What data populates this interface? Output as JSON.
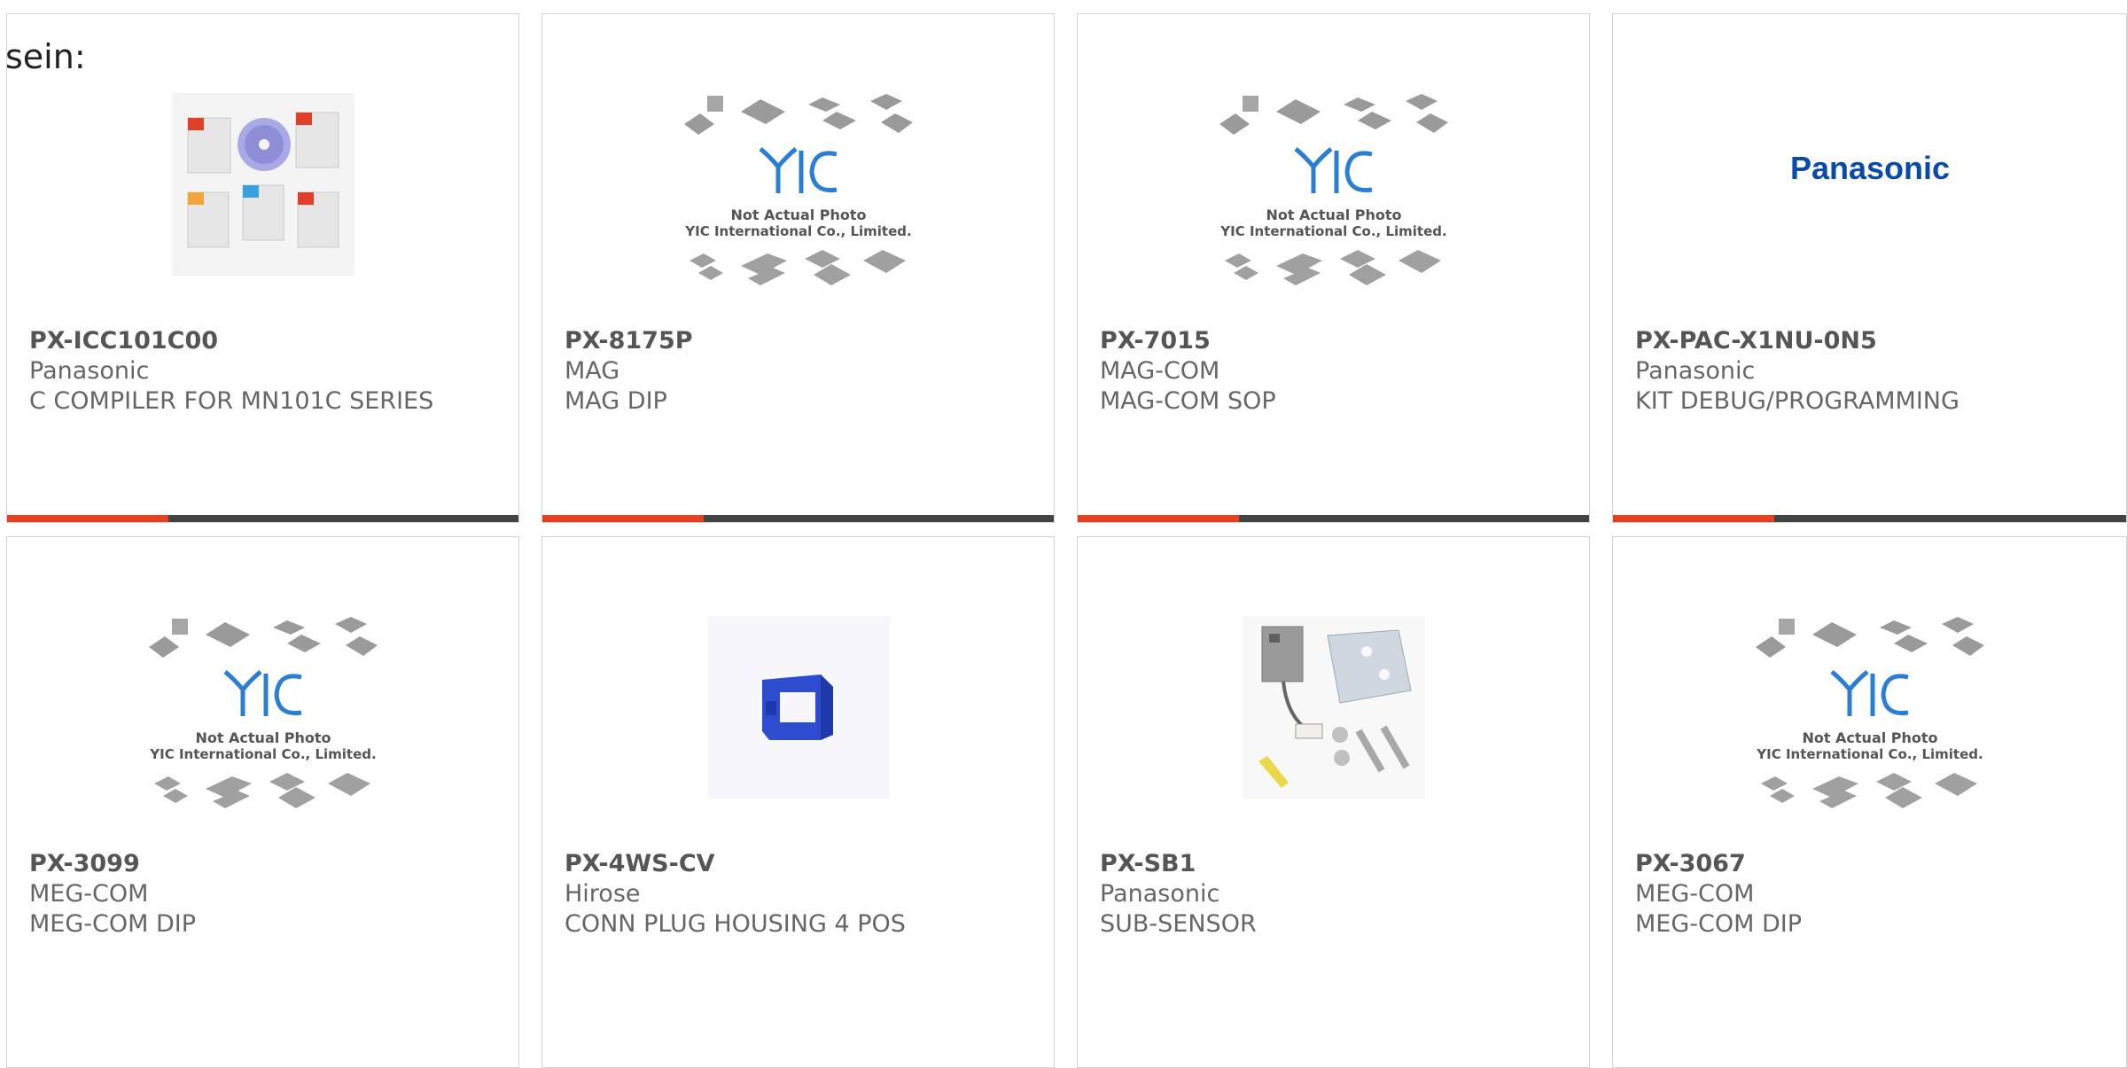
{
  "page_fragment": "sein:",
  "placeholder_image": {
    "line1": "Not Actual Photo",
    "line2": "YIC International Co., Limited."
  },
  "brand_logo_text": "Panasonic",
  "colors": {
    "accent_bar": "#e8401c",
    "bar_base": "#444444",
    "logo_blue": "#0a4aa8",
    "yic_blue": "#1e7fd6"
  },
  "products": [
    {
      "part": "PX-ICC101C00",
      "manufacturer": "Panasonic",
      "description": "C COMPILER FOR MN101C SERIES",
      "image": "manuals-cd-icon"
    },
    {
      "part": "PX-8175P",
      "manufacturer": "MAG",
      "description": "MAG DIP",
      "image": "yic-placeholder"
    },
    {
      "part": "PX-7015",
      "manufacturer": "MAG-COM",
      "description": "MAG-COM SOP",
      "image": "yic-placeholder"
    },
    {
      "part": "PX-PAC-X1NU-0N5",
      "manufacturer": "Panasonic",
      "description": "KIT DEBUG/PROGRAMMING",
      "image": "panasonic-logo"
    },
    {
      "part": "PX-3099",
      "manufacturer": "MEG-COM",
      "description": "MEG-COM DIP",
      "image": "yic-placeholder"
    },
    {
      "part": "PX-4WS-CV",
      "manufacturer": "Hirose",
      "description": "CONN PLUG HOUSING 4 POS",
      "image": "connector-housing-icon"
    },
    {
      "part": "PX-SB1",
      "manufacturer": "Panasonic",
      "description": "SUB-SENSOR",
      "image": "sensor-kit-icon"
    },
    {
      "part": "PX-3067",
      "manufacturer": "MEG-COM",
      "description": "MEG-COM DIP",
      "image": "yic-placeholder"
    }
  ]
}
